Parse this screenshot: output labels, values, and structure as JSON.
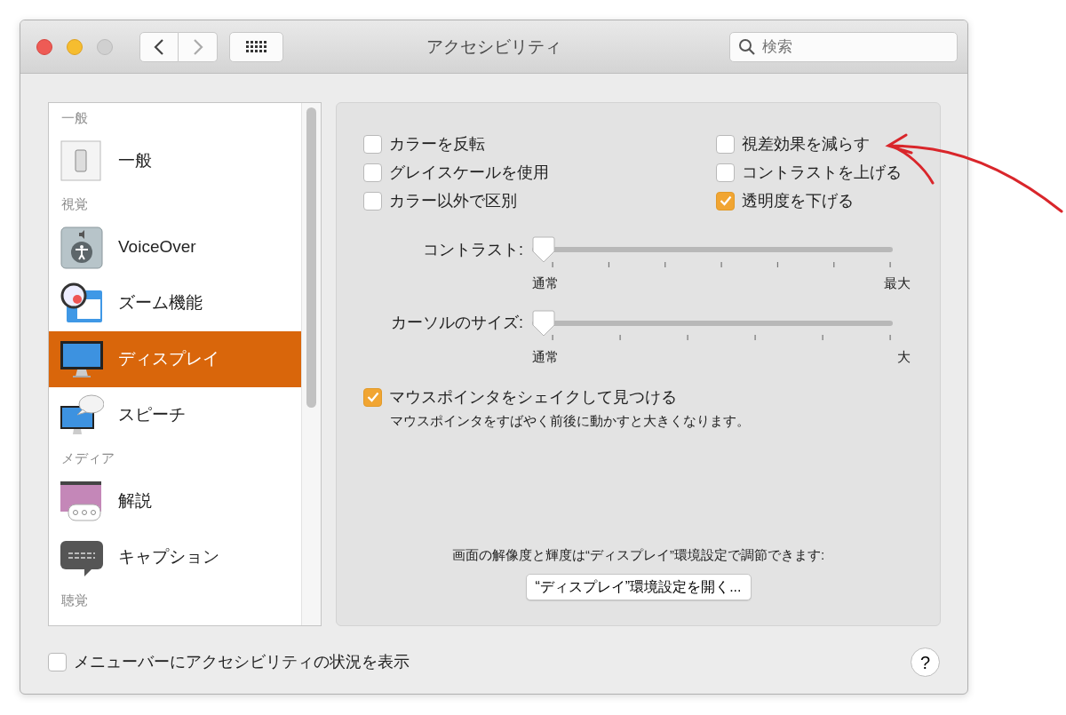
{
  "window": {
    "title": "アクセシビリティ"
  },
  "toolbar": {
    "search": {
      "placeholder": "検索"
    }
  },
  "sidebar": {
    "items": [
      {
        "kind": "header",
        "label": "一般"
      },
      {
        "kind": "item",
        "label": "一般",
        "selected": false
      },
      {
        "kind": "header",
        "label": "視覚"
      },
      {
        "kind": "item",
        "label": "VoiceOver",
        "selected": false
      },
      {
        "kind": "item",
        "label": "ズーム機能",
        "selected": false
      },
      {
        "kind": "item",
        "label": "ディスプレイ",
        "selected": true
      },
      {
        "kind": "item",
        "label": "スピーチ",
        "selected": false
      },
      {
        "kind": "header",
        "label": "メディア"
      },
      {
        "kind": "item",
        "label": "解説",
        "selected": false
      },
      {
        "kind": "item",
        "label": "キャプション",
        "selected": false
      },
      {
        "kind": "header",
        "label": "聴覚"
      }
    ]
  },
  "panel": {
    "left_options": [
      {
        "label": "カラーを反転",
        "checked": false
      },
      {
        "label": "グレイスケールを使用",
        "checked": false
      },
      {
        "label": "カラー以外で区別",
        "checked": false
      }
    ],
    "right_options": [
      {
        "label": "視差効果を減らす",
        "checked": false
      },
      {
        "label": "コントラストを上げる",
        "checked": false
      },
      {
        "label": "透明度を下げる",
        "checked": true
      }
    ],
    "sliders": [
      {
        "label": "コントラスト:",
        "level": 0,
        "min_label": "通常",
        "max_label": "最大"
      },
      {
        "label": "カーソルのサイズ:",
        "level": 0,
        "min_label": "通常",
        "max_label": "大"
      }
    ],
    "shake": {
      "label": "マウスポインタをシェイクして見つける",
      "checked": true,
      "description": "マウスポインタをすばやく前後に動かすと大きくなります。"
    },
    "note": "画面の解像度と輝度は“ディスプレイ”環境設定で調節できます:",
    "button": "“ディスプレイ”環境設定を開く..."
  },
  "footer": {
    "checkbox": {
      "label": "メニューバーにアクセシビリティの状況を表示",
      "checked": false
    },
    "help": "?"
  }
}
